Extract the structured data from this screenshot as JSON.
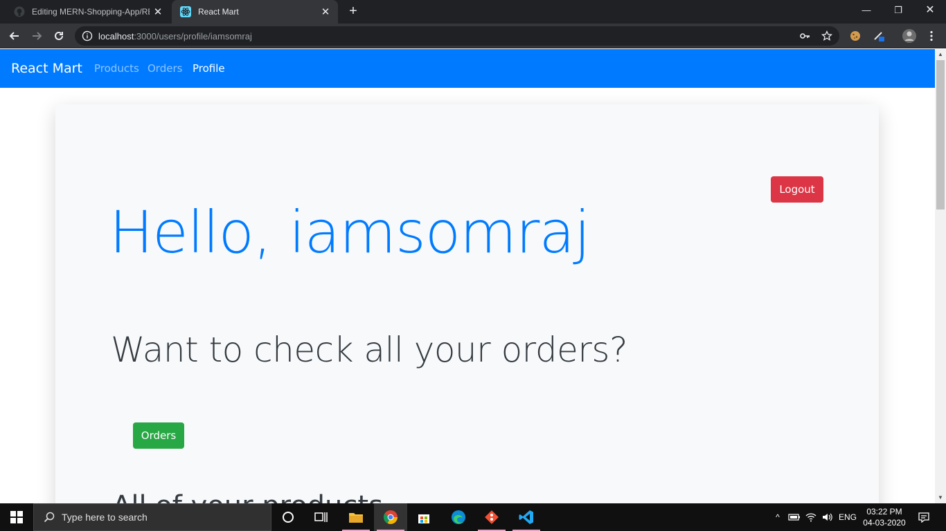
{
  "browser": {
    "tabs": [
      {
        "title": "Editing MERN-Shopping-App/RE",
        "favicon": "github-icon",
        "active": false
      },
      {
        "title": "React Mart",
        "favicon": "react-icon",
        "active": true
      }
    ],
    "url_host": "localhost",
    "url_path": ":3000/users/profile/iamsomraj"
  },
  "page": {
    "brand": "React Mart",
    "nav_links": [
      "Products",
      "Orders",
      "Profile"
    ],
    "active_nav": "Profile",
    "logout_label": "Logout",
    "greeting": "Hello, iamsomraj",
    "orders_question": "Want to check all your orders?",
    "orders_button": "Orders",
    "cut_off_heading": "All of your products"
  },
  "colors": {
    "primary": "#007bff",
    "danger": "#dc3545",
    "success": "#28a745"
  },
  "taskbar": {
    "search_placeholder": "Type here to search",
    "language": "ENG",
    "time": "03:22 PM",
    "date": "04-03-2020"
  }
}
